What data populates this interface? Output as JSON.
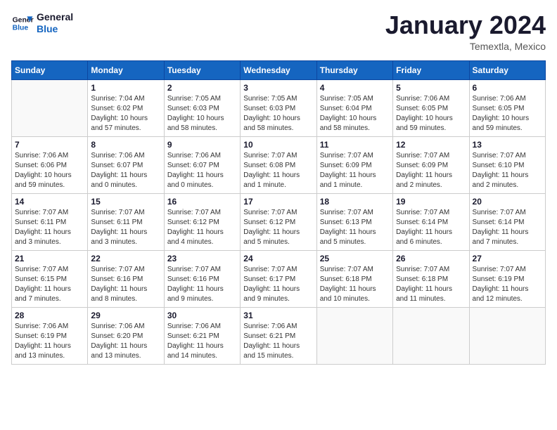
{
  "logo": {
    "text_general": "General",
    "text_blue": "Blue"
  },
  "title": "January 2024",
  "subtitle": "Temextla, Mexico",
  "weekdays": [
    "Sunday",
    "Monday",
    "Tuesday",
    "Wednesday",
    "Thursday",
    "Friday",
    "Saturday"
  ],
  "weeks": [
    [
      {
        "day": "",
        "info": ""
      },
      {
        "day": "1",
        "info": "Sunrise: 7:04 AM\nSunset: 6:02 PM\nDaylight: 10 hours\nand 57 minutes."
      },
      {
        "day": "2",
        "info": "Sunrise: 7:05 AM\nSunset: 6:03 PM\nDaylight: 10 hours\nand 58 minutes."
      },
      {
        "day": "3",
        "info": "Sunrise: 7:05 AM\nSunset: 6:03 PM\nDaylight: 10 hours\nand 58 minutes."
      },
      {
        "day": "4",
        "info": "Sunrise: 7:05 AM\nSunset: 6:04 PM\nDaylight: 10 hours\nand 58 minutes."
      },
      {
        "day": "5",
        "info": "Sunrise: 7:06 AM\nSunset: 6:05 PM\nDaylight: 10 hours\nand 59 minutes."
      },
      {
        "day": "6",
        "info": "Sunrise: 7:06 AM\nSunset: 6:05 PM\nDaylight: 10 hours\nand 59 minutes."
      }
    ],
    [
      {
        "day": "7",
        "info": "Sunrise: 7:06 AM\nSunset: 6:06 PM\nDaylight: 10 hours\nand 59 minutes."
      },
      {
        "day": "8",
        "info": "Sunrise: 7:06 AM\nSunset: 6:07 PM\nDaylight: 11 hours\nand 0 minutes."
      },
      {
        "day": "9",
        "info": "Sunrise: 7:06 AM\nSunset: 6:07 PM\nDaylight: 11 hours\nand 0 minutes."
      },
      {
        "day": "10",
        "info": "Sunrise: 7:07 AM\nSunset: 6:08 PM\nDaylight: 11 hours\nand 1 minute."
      },
      {
        "day": "11",
        "info": "Sunrise: 7:07 AM\nSunset: 6:09 PM\nDaylight: 11 hours\nand 1 minute."
      },
      {
        "day": "12",
        "info": "Sunrise: 7:07 AM\nSunset: 6:09 PM\nDaylight: 11 hours\nand 2 minutes."
      },
      {
        "day": "13",
        "info": "Sunrise: 7:07 AM\nSunset: 6:10 PM\nDaylight: 11 hours\nand 2 minutes."
      }
    ],
    [
      {
        "day": "14",
        "info": "Sunrise: 7:07 AM\nSunset: 6:11 PM\nDaylight: 11 hours\nand 3 minutes."
      },
      {
        "day": "15",
        "info": "Sunrise: 7:07 AM\nSunset: 6:11 PM\nDaylight: 11 hours\nand 3 minutes."
      },
      {
        "day": "16",
        "info": "Sunrise: 7:07 AM\nSunset: 6:12 PM\nDaylight: 11 hours\nand 4 minutes."
      },
      {
        "day": "17",
        "info": "Sunrise: 7:07 AM\nSunset: 6:12 PM\nDaylight: 11 hours\nand 5 minutes."
      },
      {
        "day": "18",
        "info": "Sunrise: 7:07 AM\nSunset: 6:13 PM\nDaylight: 11 hours\nand 5 minutes."
      },
      {
        "day": "19",
        "info": "Sunrise: 7:07 AM\nSunset: 6:14 PM\nDaylight: 11 hours\nand 6 minutes."
      },
      {
        "day": "20",
        "info": "Sunrise: 7:07 AM\nSunset: 6:14 PM\nDaylight: 11 hours\nand 7 minutes."
      }
    ],
    [
      {
        "day": "21",
        "info": "Sunrise: 7:07 AM\nSunset: 6:15 PM\nDaylight: 11 hours\nand 7 minutes."
      },
      {
        "day": "22",
        "info": "Sunrise: 7:07 AM\nSunset: 6:16 PM\nDaylight: 11 hours\nand 8 minutes."
      },
      {
        "day": "23",
        "info": "Sunrise: 7:07 AM\nSunset: 6:16 PM\nDaylight: 11 hours\nand 9 minutes."
      },
      {
        "day": "24",
        "info": "Sunrise: 7:07 AM\nSunset: 6:17 PM\nDaylight: 11 hours\nand 9 minutes."
      },
      {
        "day": "25",
        "info": "Sunrise: 7:07 AM\nSunset: 6:18 PM\nDaylight: 11 hours\nand 10 minutes."
      },
      {
        "day": "26",
        "info": "Sunrise: 7:07 AM\nSunset: 6:18 PM\nDaylight: 11 hours\nand 11 minutes."
      },
      {
        "day": "27",
        "info": "Sunrise: 7:07 AM\nSunset: 6:19 PM\nDaylight: 11 hours\nand 12 minutes."
      }
    ],
    [
      {
        "day": "28",
        "info": "Sunrise: 7:06 AM\nSunset: 6:19 PM\nDaylight: 11 hours\nand 13 minutes."
      },
      {
        "day": "29",
        "info": "Sunrise: 7:06 AM\nSunset: 6:20 PM\nDaylight: 11 hours\nand 13 minutes."
      },
      {
        "day": "30",
        "info": "Sunrise: 7:06 AM\nSunset: 6:21 PM\nDaylight: 11 hours\nand 14 minutes."
      },
      {
        "day": "31",
        "info": "Sunrise: 7:06 AM\nSunset: 6:21 PM\nDaylight: 11 hours\nand 15 minutes."
      },
      {
        "day": "",
        "info": ""
      },
      {
        "day": "",
        "info": ""
      },
      {
        "day": "",
        "info": ""
      }
    ]
  ]
}
